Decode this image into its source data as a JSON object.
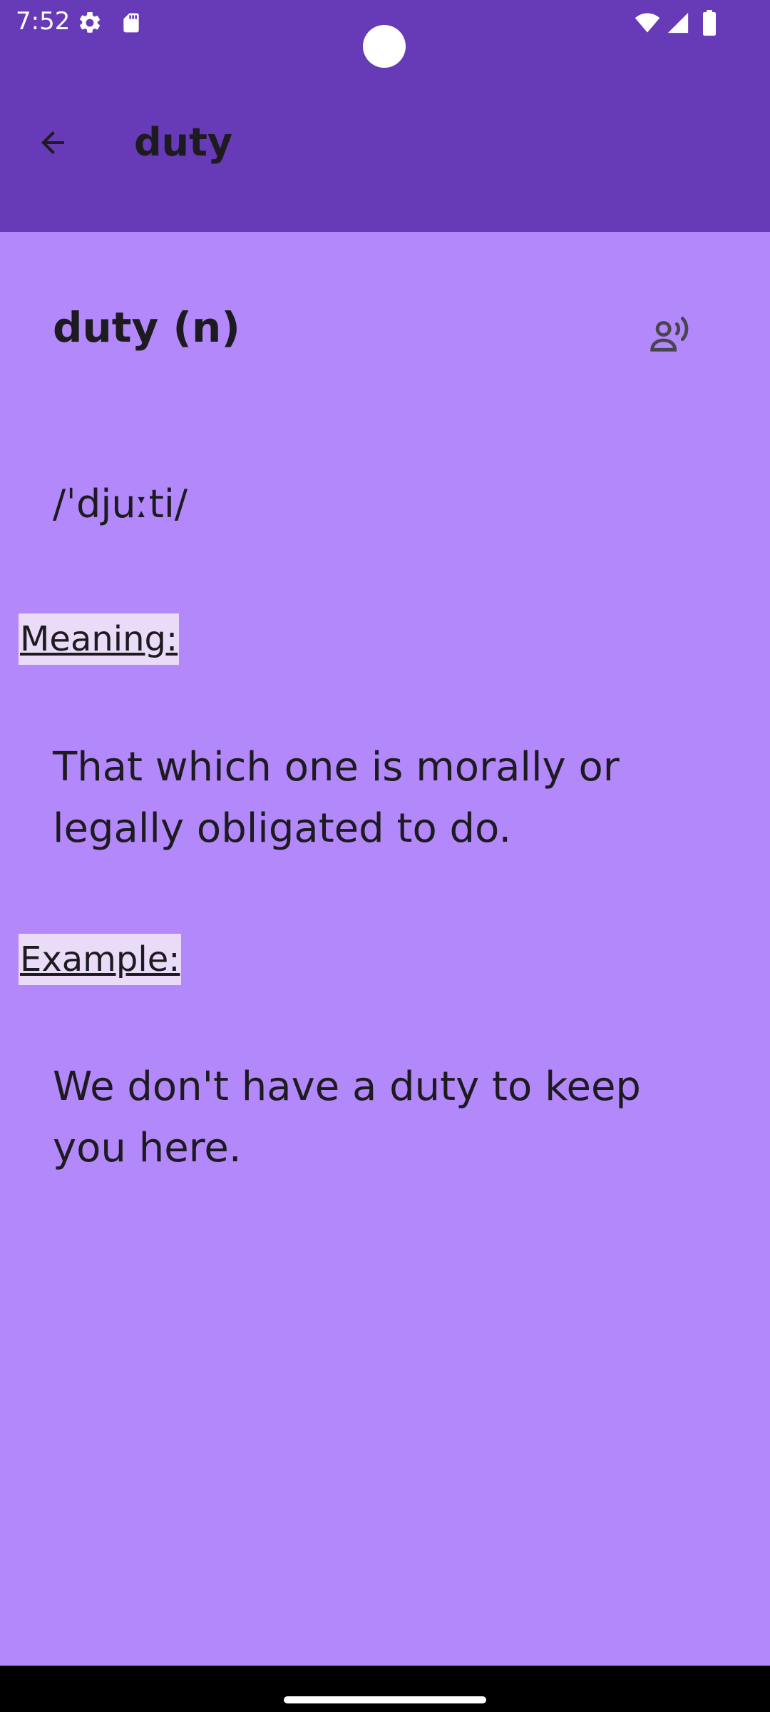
{
  "status_bar": {
    "time": "7:52",
    "icons": [
      "settings-icon",
      "sd-card-icon",
      "wifi-icon",
      "signal-icon",
      "battery-icon"
    ]
  },
  "app_bar": {
    "title": "duty",
    "back_icon": "arrow-back-icon"
  },
  "entry": {
    "heading": "duty (n)",
    "speak_icon": "record-voice-icon",
    "phonetic": "/ˈdjuːti/",
    "meaning_label": "Meaning:",
    "meaning_text": "That which one is morally or legally obligated to do.",
    "example_label": "Example:",
    "example_text": "We don't have a duty to keep you here."
  },
  "colors": {
    "app_bar": "#673ab7",
    "background": "#b388fb",
    "label_highlight": "#eadcf8",
    "text": "#1d1b20"
  }
}
